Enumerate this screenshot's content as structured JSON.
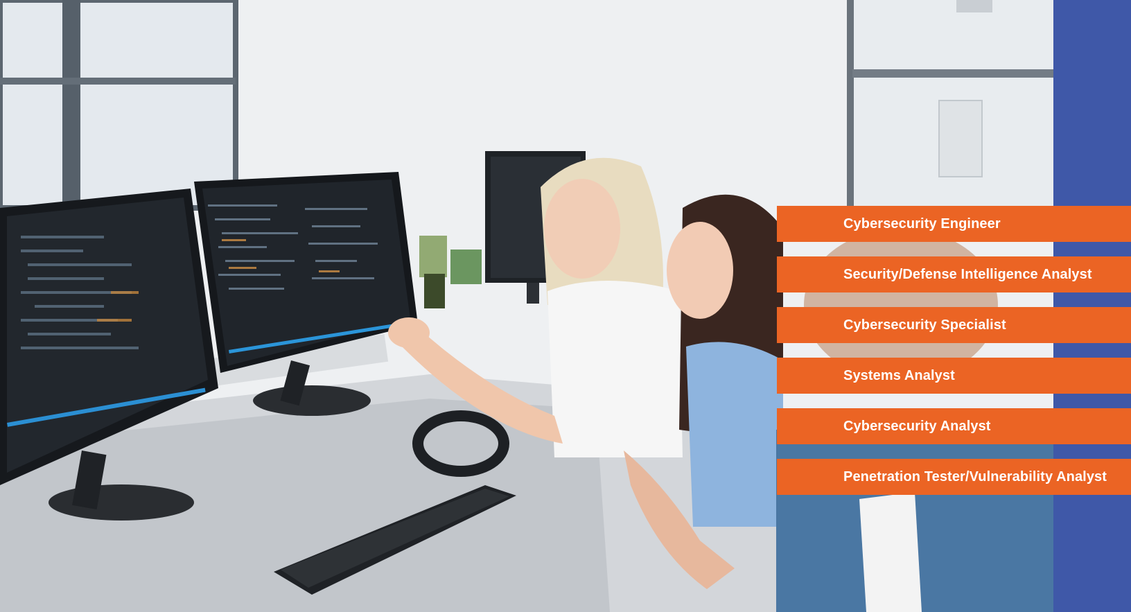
{
  "colors": {
    "accent_orange": "#eb6424",
    "band_blue": "#3f58a8",
    "role_text": "#ffffff"
  },
  "roles": [
    {
      "label": "Cybersecurity Engineer"
    },
    {
      "label": "Security/Defense Intelligence Analyst"
    },
    {
      "label": "Cybersecurity Specialist"
    },
    {
      "label": "Systems Analyst"
    },
    {
      "label": "Cybersecurity Analyst"
    },
    {
      "label": "Penetration Tester/Vulnerability Analyst"
    }
  ]
}
